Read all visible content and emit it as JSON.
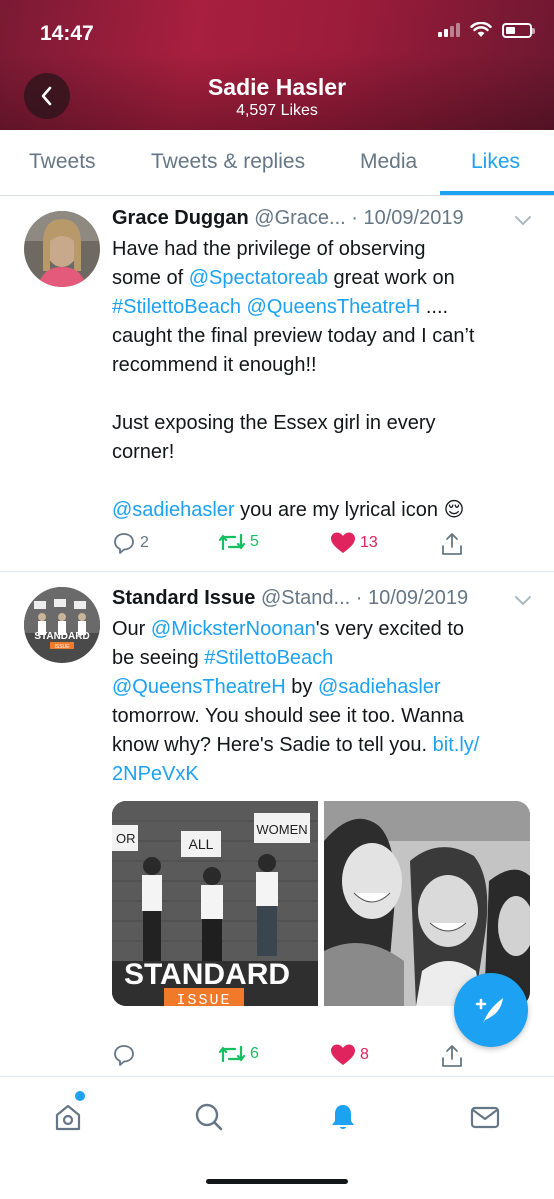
{
  "status_bar": {
    "time": "14:47"
  },
  "profile": {
    "name": "Sadie Hasler",
    "likes": "4,597 Likes"
  },
  "tabs": [
    {
      "label": "Tweets",
      "active": false
    },
    {
      "label": "Tweets & replies",
      "active": false
    },
    {
      "label": "Media",
      "active": false
    },
    {
      "label": "Likes",
      "active": true
    }
  ],
  "tweets": [
    {
      "name": "Grace Duggan",
      "handle": "@Grace...",
      "date": "· 10/09/2019",
      "text": {
        "l1a": "Have had the privilege of observing",
        "l2a": "some of ",
        "l2b": "@Spectatoreab",
        "l2c": " great work on",
        "l3a": "#StilettoBeach",
        "l3b": " ",
        "l3c": "@QueensTheatreH",
        "l3d": " ....",
        "l4a": "caught the final preview today and I can’t",
        "l5a": "recommend it enough!!",
        "p2a": "Just exposing the Essex girl in every",
        "p2b": "corner!",
        "p3a": "@sadiehasler",
        "p3b": " you are my lyrical icon ",
        "emoji": "😌"
      },
      "replies": "2",
      "retweets": "5",
      "likes": "13"
    },
    {
      "name": "Standard Issue",
      "handle": "@Stand...",
      "date": "· 10/09/2019",
      "text": {
        "l1a": "Our ",
        "l1b": "@MicksterNoonan",
        "l1c": "'s very excited to",
        "l2a": "be seeing ",
        "l2b": "#StilettoBeach",
        "l3a": "@QueensTheatreH",
        "l3b": " by ",
        "l3c": "@sadiehasler",
        "l4a": "tomorrow. You should see it too. Wanna",
        "l5a": "know why? Here's Sadie to tell you. ",
        "l5b": "bit.ly/",
        "l6a": "2NPeVxK"
      },
      "media_left": {
        "sign1": "OR",
        "sign2": "ALL",
        "sign3": "WOMEN",
        "brand_top": "STANDARD",
        "brand_bottom": "ISSUE"
      },
      "avatar_brand": {
        "top": "STANDARD",
        "bottom": "ISSUE"
      },
      "replies": "",
      "retweets": "6",
      "likes": "8"
    }
  ],
  "colors": {
    "accent": "#1da1f2",
    "retweet": "#17bf63",
    "like": "#e0245e",
    "header": "#a81f3f"
  }
}
